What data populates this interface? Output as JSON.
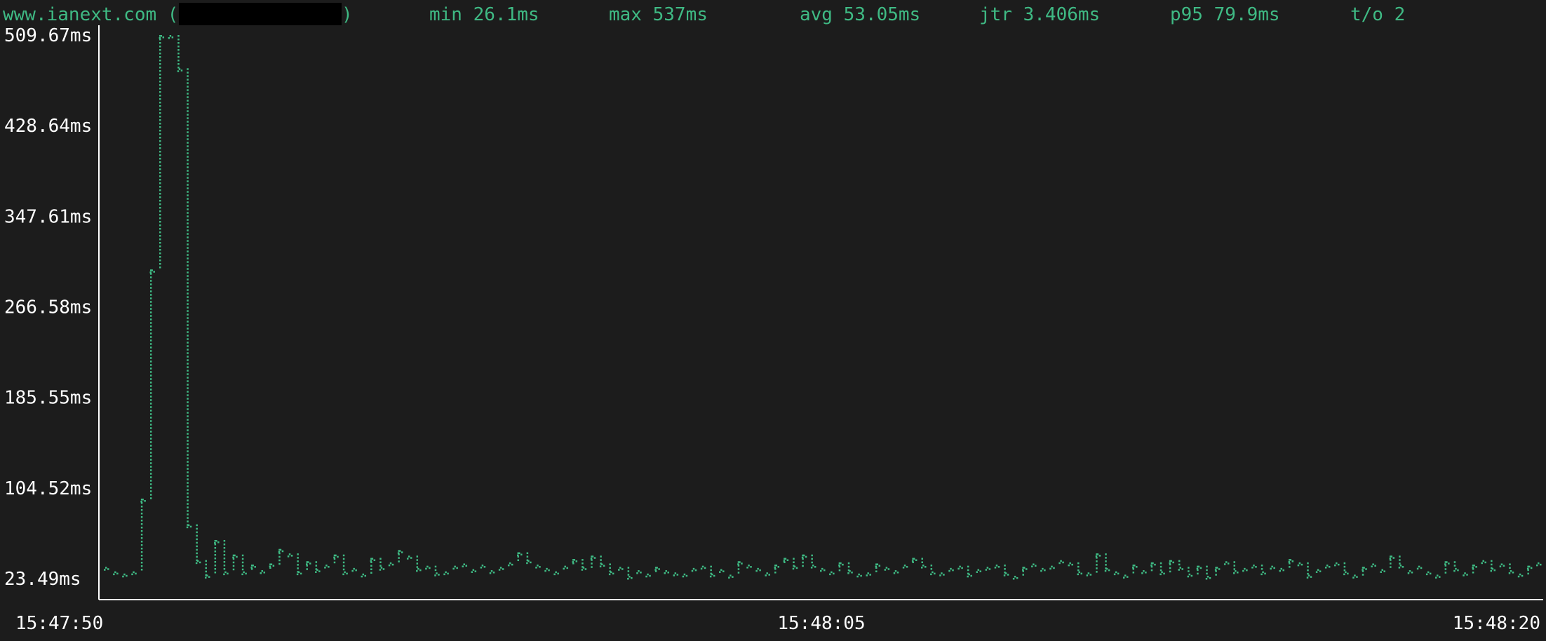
{
  "header": {
    "host_open": "www.ianext.com (",
    "host_close": ")",
    "min": "min 26.1ms",
    "max": "max 537ms",
    "avg": "avg 53.05ms",
    "jtr": "jtr 3.406ms",
    "p95": "p95 79.9ms",
    "timeouts": "t/o 2"
  },
  "colors": {
    "accent": "#3fba84",
    "axis": "#ffffff",
    "background": "#1c1c1c"
  },
  "chart_data": {
    "type": "scatter",
    "title": "",
    "xlabel": "",
    "ylabel": "",
    "grid": false,
    "ylim": [
      23.49,
      509.67
    ],
    "y_unit": "ms",
    "yticks": [
      "509.67ms",
      "428.64ms",
      "347.61ms",
      "266.58ms",
      "185.55ms",
      "104.52ms",
      "23.49ms"
    ],
    "xticks": [
      "15:47:50",
      "15:48:05",
      "15:48:20"
    ],
    "x_range": [
      "15:47:50",
      "15:48:20"
    ],
    "x_tick_seconds": [
      0,
      15,
      30
    ],
    "series": [
      {
        "values_ms": [
          34,
          30,
          28,
          30,
          95,
          300,
          537,
          510,
          480,
          72,
          40,
          27,
          58,
          30,
          45,
          30,
          36,
          31,
          37,
          50,
          46,
          30,
          39,
          32,
          36,
          45,
          30,
          33,
          28,
          42,
          34,
          38,
          49,
          44,
          33,
          35,
          29,
          30,
          35,
          37,
          32,
          36,
          31,
          34,
          38,
          47,
          40,
          36,
          33,
          30,
          35,
          41,
          34,
          44,
          37,
          30,
          34,
          26,
          31,
          28,
          34,
          31,
          29,
          28,
          33,
          35,
          28,
          32,
          27,
          39,
          36,
          33,
          29,
          36,
          42,
          35,
          45,
          36,
          33,
          30,
          38,
          31,
          28,
          29,
          37,
          34,
          31,
          36,
          42,
          36,
          30,
          29,
          33,
          35,
          28,
          32,
          34,
          36,
          29,
          26,
          34,
          37,
          33,
          35,
          40,
          38,
          30,
          29,
          46,
          33,
          30,
          27,
          36,
          31,
          38,
          30,
          40,
          34,
          28,
          35,
          26,
          34,
          39,
          31,
          33,
          36,
          30,
          35,
          33,
          41,
          38,
          27,
          32,
          36,
          38,
          30,
          27,
          34,
          37,
          32,
          44,
          36,
          31,
          35,
          30,
          27,
          39,
          33,
          29,
          36,
          40,
          33,
          37,
          31,
          28,
          35,
          38
        ]
      }
    ]
  }
}
